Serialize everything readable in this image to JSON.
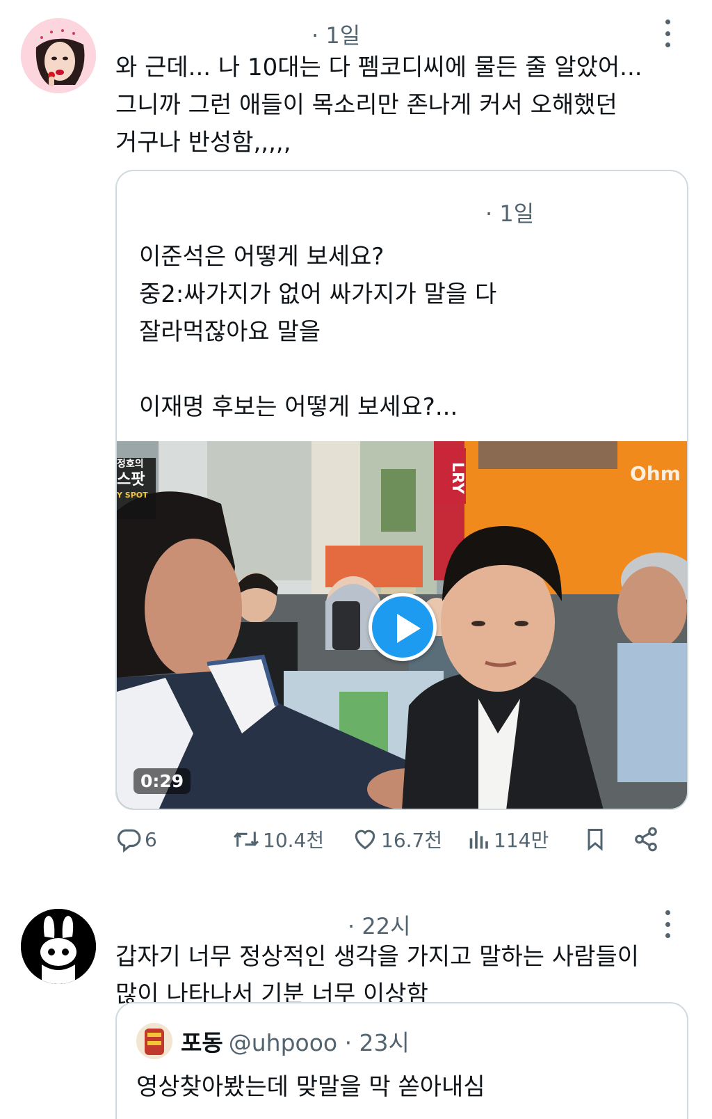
{
  "tweets": [
    {
      "time": "· 1일",
      "text": "와 근데... 나 10대는 다 펨코디씨에 물든 줄 알았어...\n그니까 그런 애들이 목소리만 존나게 커서 오해했던\n거구나 반성함,,,,,",
      "quote": {
        "time": "· 1일",
        "text": "이준석은 어떻게 보세요?\n중2:싸가지가 없어 싸가지가 말을 다\n잘라먹잖아요 말을\n\n이재명 후보는 어떻게 보세요?...",
        "video": {
          "duration": "0:29",
          "channel_logo": [
            "정호의",
            "스팟",
            "Y SPOT"
          ],
          "store_sign": "Ohm",
          "banner_sign": "LRY"
        }
      },
      "actions": {
        "reply": "6",
        "retweet": "10.4천",
        "like": "16.7천",
        "views": "114만"
      }
    },
    {
      "time": "· 22시",
      "text": "갑자기 너무 정상적인 생각을 가지고 말하는 사람들이\n많이 나타나서 기분 너무 이상함",
      "quote": {
        "name": "포동",
        "handle": "@uhpooo · 23시",
        "text": "영상찾아봤는데 맞말을 막 쏟아내심"
      }
    }
  ],
  "colors": {
    "accent": "#1d9bf0",
    "text": "#0f1419",
    "muted": "#536471",
    "border": "#cfd9de"
  },
  "icons": [
    "more-icon",
    "reply-icon",
    "retweet-icon",
    "like-icon",
    "views-icon",
    "bookmark-icon",
    "share-icon",
    "play-icon"
  ]
}
